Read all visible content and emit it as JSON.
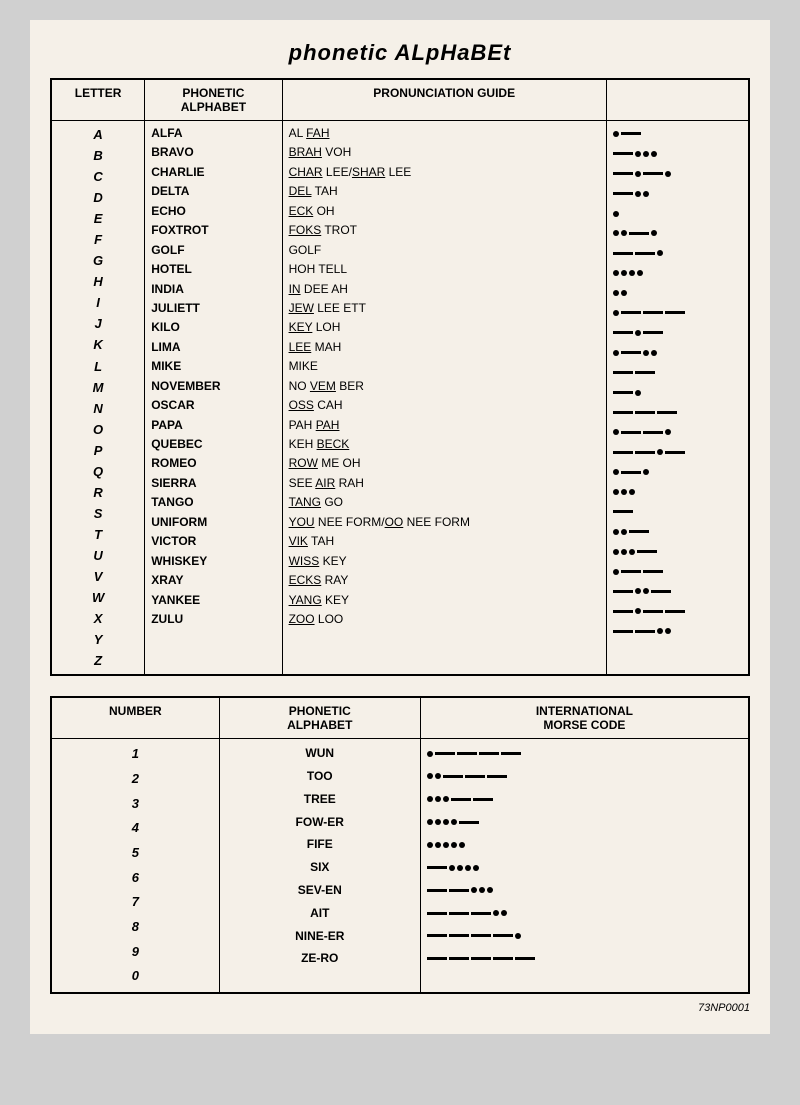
{
  "title": "phonetic ALpHaBEt",
  "table1": {
    "headers": [
      "LETTER",
      "PHONETIC\nALPHABET",
      "PRONUNCIATION GUIDE",
      ""
    ],
    "rows": [
      {
        "letter": "A",
        "phonetic": "ALFA",
        "pronunciation": [
          {
            "text": "AL ",
            "u": false
          },
          {
            "text": "FAH",
            "u": true
          }
        ]
      },
      {
        "letter": "B",
        "phonetic": "BRAVO",
        "pronunciation": [
          {
            "text": "BRAH",
            "u": true
          },
          {
            "text": " VOH",
            "u": false
          }
        ]
      },
      {
        "letter": "C",
        "phonetic": "CHARLIE",
        "pronunciation": [
          {
            "text": "CHAR",
            "u": true
          },
          {
            "text": " LEE/",
            "u": false
          },
          {
            "text": "SHAR",
            "u": true
          },
          {
            "text": " LEE",
            "u": false
          }
        ]
      },
      {
        "letter": "D",
        "phonetic": "DELTA",
        "pronunciation": [
          {
            "text": "DEL",
            "u": true
          },
          {
            "text": " TAH",
            "u": false
          }
        ]
      },
      {
        "letter": "E",
        "phonetic": "ECHO",
        "pronunciation": [
          {
            "text": "ECK",
            "u": true
          },
          {
            "text": " OH",
            "u": false
          }
        ]
      },
      {
        "letter": "F",
        "phonetic": "FOXTROT",
        "pronunciation": [
          {
            "text": "FOKS",
            "u": true
          },
          {
            "text": " TROT",
            "u": false
          }
        ]
      },
      {
        "letter": "G",
        "phonetic": "GOLF",
        "pronunciation": [
          {
            "text": "GOLF",
            "u": false
          }
        ]
      },
      {
        "letter": "H",
        "phonetic": "HOTEL",
        "pronunciation": [
          {
            "text": "HOH TELL",
            "u": false
          }
        ]
      },
      {
        "letter": "I",
        "phonetic": "INDIA",
        "pronunciation": [
          {
            "text": "IN",
            "u": true
          },
          {
            "text": " DEE AH",
            "u": false
          }
        ]
      },
      {
        "letter": "J",
        "phonetic": "JULIETT",
        "pronunciation": [
          {
            "text": "JEW",
            "u": true
          },
          {
            "text": " LEE ETT",
            "u": false
          }
        ]
      },
      {
        "letter": "K",
        "phonetic": "KILO",
        "pronunciation": [
          {
            "text": "KEY",
            "u": true
          },
          {
            "text": " LOH",
            "u": false
          }
        ]
      },
      {
        "letter": "L",
        "phonetic": "LIMA",
        "pronunciation": [
          {
            "text": "LEE",
            "u": true
          },
          {
            "text": " MAH",
            "u": false
          }
        ]
      },
      {
        "letter": "M",
        "phonetic": "MIKE",
        "pronunciation": [
          {
            "text": "MIKE",
            "u": false
          }
        ]
      },
      {
        "letter": "N",
        "phonetic": "NOVEMBER",
        "pronunciation": [
          {
            "text": "NO ",
            "u": false
          },
          {
            "text": "VEM",
            "u": true
          },
          {
            "text": " BER",
            "u": false
          }
        ]
      },
      {
        "letter": "O",
        "phonetic": "OSCAR",
        "pronunciation": [
          {
            "text": "OSS",
            "u": true
          },
          {
            "text": " CAH",
            "u": false
          }
        ]
      },
      {
        "letter": "P",
        "phonetic": "PAPA",
        "pronunciation": [
          {
            "text": "PAH ",
            "u": false
          },
          {
            "text": "PAH",
            "u": true
          }
        ]
      },
      {
        "letter": "Q",
        "phonetic": "QUEBEC",
        "pronunciation": [
          {
            "text": "KEH ",
            "u": false
          },
          {
            "text": "BECK",
            "u": true
          }
        ]
      },
      {
        "letter": "R",
        "phonetic": "ROMEO",
        "pronunciation": [
          {
            "text": "ROW",
            "u": true
          },
          {
            "text": " ME OH",
            "u": false
          }
        ]
      },
      {
        "letter": "S",
        "phonetic": "SIERRA",
        "pronunciation": [
          {
            "text": "SEE ",
            "u": false
          },
          {
            "text": "AIR",
            "u": true
          },
          {
            "text": " RAH",
            "u": false
          }
        ]
      },
      {
        "letter": "T",
        "phonetic": "TANGO",
        "pronunciation": [
          {
            "text": "TANG",
            "u": true
          },
          {
            "text": " GO",
            "u": false
          }
        ]
      },
      {
        "letter": "U",
        "phonetic": "UNIFORM",
        "pronunciation": [
          {
            "text": "YOU",
            "u": true
          },
          {
            "text": " NEE FORM/",
            "u": false
          },
          {
            "text": "OO",
            "u": true
          },
          {
            "text": " NEE FORM",
            "u": false
          }
        ]
      },
      {
        "letter": "V",
        "phonetic": "VICTOR",
        "pronunciation": [
          {
            "text": "VIK",
            "u": true
          },
          {
            "text": " TAH",
            "u": false
          }
        ]
      },
      {
        "letter": "W",
        "phonetic": "WHISKEY",
        "pronunciation": [
          {
            "text": "WISS",
            "u": true
          },
          {
            "text": " KEY",
            "u": false
          }
        ]
      },
      {
        "letter": "X",
        "phonetic": "XRAY",
        "pronunciation": [
          {
            "text": "ECKS",
            "u": true
          },
          {
            "text": " RAY",
            "u": false
          }
        ]
      },
      {
        "letter": "Y",
        "phonetic": "YANKEE",
        "pronunciation": [
          {
            "text": "YANG",
            "u": true
          },
          {
            "text": " KEY",
            "u": false
          }
        ]
      },
      {
        "letter": "Z",
        "phonetic": "ZULU",
        "pronunciation": [
          {
            "text": "ZOO",
            "u": true
          },
          {
            "text": " LOO",
            "u": false
          }
        ]
      }
    ],
    "morse": [
      [
        {
          "t": "dot"
        },
        {
          "t": "dash"
        }
      ],
      [
        {
          "t": "dash"
        },
        {
          "t": "dot"
        },
        {
          "t": "dot"
        },
        {
          "t": "dot"
        }
      ],
      [
        {
          "t": "dash"
        },
        {
          "t": "dot"
        },
        {
          "t": "dash"
        },
        {
          "t": "dot"
        }
      ],
      [
        {
          "t": "dash"
        },
        {
          "t": "dot"
        },
        {
          "t": "dot"
        }
      ],
      [
        {
          "t": "dot"
        }
      ],
      [
        {
          "t": "dot"
        },
        {
          "t": "dot"
        },
        {
          "t": "dash"
        },
        {
          "t": "dot"
        }
      ],
      [
        {
          "t": "dash"
        },
        {
          "t": "dash"
        },
        {
          "t": "dot"
        }
      ],
      [
        {
          "t": "dot"
        },
        {
          "t": "dot"
        },
        {
          "t": "dot"
        },
        {
          "t": "dot"
        }
      ],
      [
        {
          "t": "dot"
        },
        {
          "t": "dot"
        }
      ],
      [
        {
          "t": "dot"
        },
        {
          "t": "dash"
        },
        {
          "t": "dash"
        },
        {
          "t": "dash"
        }
      ],
      [
        {
          "t": "dash"
        },
        {
          "t": "dot"
        },
        {
          "t": "dash"
        }
      ],
      [
        {
          "t": "dot"
        },
        {
          "t": "dash"
        },
        {
          "t": "dot"
        },
        {
          "t": "dot"
        }
      ],
      [
        {
          "t": "dash"
        },
        {
          "t": "dash"
        }
      ],
      [
        {
          "t": "dash"
        },
        {
          "t": "dot"
        }
      ],
      [
        {
          "t": "dash"
        },
        {
          "t": "dash"
        },
        {
          "t": "dash"
        }
      ],
      [
        {
          "t": "dot"
        },
        {
          "t": "dash"
        },
        {
          "t": "dash"
        },
        {
          "t": "dot"
        }
      ],
      [
        {
          "t": "dash"
        },
        {
          "t": "dash"
        },
        {
          "t": "dot"
        },
        {
          "t": "dash"
        }
      ],
      [
        {
          "t": "dot"
        },
        {
          "t": "dash"
        },
        {
          "t": "dot"
        }
      ],
      [
        {
          "t": "dot"
        },
        {
          "t": "dot"
        },
        {
          "t": "dot"
        }
      ],
      [
        {
          "t": "dash"
        }
      ],
      [
        {
          "t": "dot"
        },
        {
          "t": "dot"
        },
        {
          "t": "dash"
        }
      ],
      [
        {
          "t": "dot"
        },
        {
          "t": "dot"
        },
        {
          "t": "dot"
        },
        {
          "t": "dash"
        }
      ],
      [
        {
          "t": "dot"
        },
        {
          "t": "dash"
        },
        {
          "t": "dash"
        }
      ],
      [
        {
          "t": "dash"
        },
        {
          "t": "dot"
        },
        {
          "t": "dot"
        },
        {
          "t": "dash"
        }
      ],
      [
        {
          "t": "dash"
        },
        {
          "t": "dot"
        },
        {
          "t": "dash"
        },
        {
          "t": "dash"
        }
      ],
      [
        {
          "t": "dash"
        },
        {
          "t": "dash"
        },
        {
          "t": "dot"
        },
        {
          "t": "dot"
        }
      ]
    ]
  },
  "table2": {
    "headers": [
      "NUMBER",
      "PHONETIC\nALPHABET",
      "INTERNATIONAL\nMORSE CODE"
    ],
    "rows": [
      {
        "number": "1",
        "phonetic": "WUN"
      },
      {
        "number": "2",
        "phonetic": "TOO"
      },
      {
        "number": "3",
        "phonetic": "TREE"
      },
      {
        "number": "4",
        "phonetic": "FOW-ER"
      },
      {
        "number": "5",
        "phonetic": "FIFE"
      },
      {
        "number": "6",
        "phonetic": "SIX"
      },
      {
        "number": "7",
        "phonetic": "SEV-EN"
      },
      {
        "number": "8",
        "phonetic": "AIT"
      },
      {
        "number": "9",
        "phonetic": "NINE-ER"
      },
      {
        "number": "0",
        "phonetic": "ZE-RO"
      }
    ],
    "morse": [
      [
        {
          "t": "dot"
        },
        {
          "t": "dash"
        },
        {
          "t": "dash"
        },
        {
          "t": "dash"
        },
        {
          "t": "dash"
        }
      ],
      [
        {
          "t": "dot"
        },
        {
          "t": "dot"
        },
        {
          "t": "dash"
        },
        {
          "t": "dash"
        },
        {
          "t": "dash"
        }
      ],
      [
        {
          "t": "dot"
        },
        {
          "t": "dot"
        },
        {
          "t": "dot"
        },
        {
          "t": "dash"
        },
        {
          "t": "dash"
        }
      ],
      [
        {
          "t": "dot"
        },
        {
          "t": "dot"
        },
        {
          "t": "dot"
        },
        {
          "t": "dot"
        },
        {
          "t": "dash"
        }
      ],
      [
        {
          "t": "dot"
        },
        {
          "t": "dot"
        },
        {
          "t": "dot"
        },
        {
          "t": "dot"
        },
        {
          "t": "dot"
        }
      ],
      [
        {
          "t": "dash"
        },
        {
          "t": "dot"
        },
        {
          "t": "dot"
        },
        {
          "t": "dot"
        },
        {
          "t": "dot"
        }
      ],
      [
        {
          "t": "dash"
        },
        {
          "t": "dash"
        },
        {
          "t": "dot"
        },
        {
          "t": "dot"
        },
        {
          "t": "dot"
        }
      ],
      [
        {
          "t": "dash"
        },
        {
          "t": "dash"
        },
        {
          "t": "dash"
        },
        {
          "t": "dot"
        },
        {
          "t": "dot"
        }
      ],
      [
        {
          "t": "dash"
        },
        {
          "t": "dash"
        },
        {
          "t": "dash"
        },
        {
          "t": "dash"
        },
        {
          "t": "dot"
        }
      ],
      [
        {
          "t": "dash"
        },
        {
          "t": "dash"
        },
        {
          "t": "dash"
        },
        {
          "t": "dash"
        },
        {
          "t": "dash"
        }
      ]
    ]
  },
  "doc_number": "73NP0001"
}
